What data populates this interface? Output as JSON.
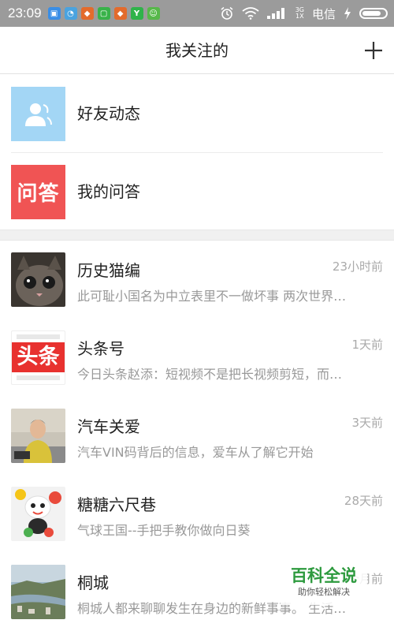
{
  "status_bar": {
    "time": "23:09",
    "network_top": "3G",
    "network_bottom": "1X",
    "carrier": "电信",
    "battery_level": 0.85
  },
  "header": {
    "title": "我关注的",
    "add_icon": "plus-icon"
  },
  "top_items": [
    {
      "label": "好友动态",
      "icon": "friends-icon",
      "color": "#a3d6f5"
    },
    {
      "label": "我的问答",
      "icon": "qa-logo",
      "logo_text": "问答",
      "color": "#f05454"
    }
  ],
  "feed": [
    {
      "name": "历史猫编",
      "time": "23小时前",
      "summary": "此可耻小国名为中立表里不一做坏事 两次世界…"
    },
    {
      "name": "头条号",
      "time": "1天前",
      "summary": "今日头条赵添：短视频不是把长视频剪短，而…",
      "logo_text": "头条"
    },
    {
      "name": "汽车关爱",
      "time": "3天前",
      "summary": "汽车VIN码背后的信息，爱车从了解它开始"
    },
    {
      "name": "糖糖六尺巷",
      "time": "28天前",
      "summary": "气球王国--手把手教你做向日葵"
    },
    {
      "name": "桐城",
      "time": "1个月前",
      "summary": "桐城人都来聊聊发生在身边的新鲜事事。 生活…"
    }
  ],
  "watermark": {
    "title": "百科全说",
    "subtitle": "助你轻松解决"
  },
  "colors": {
    "status_bar": "#9b9b9b",
    "divider": "#ececec",
    "secondary_text": "#999999",
    "accent_red": "#e8312f"
  }
}
